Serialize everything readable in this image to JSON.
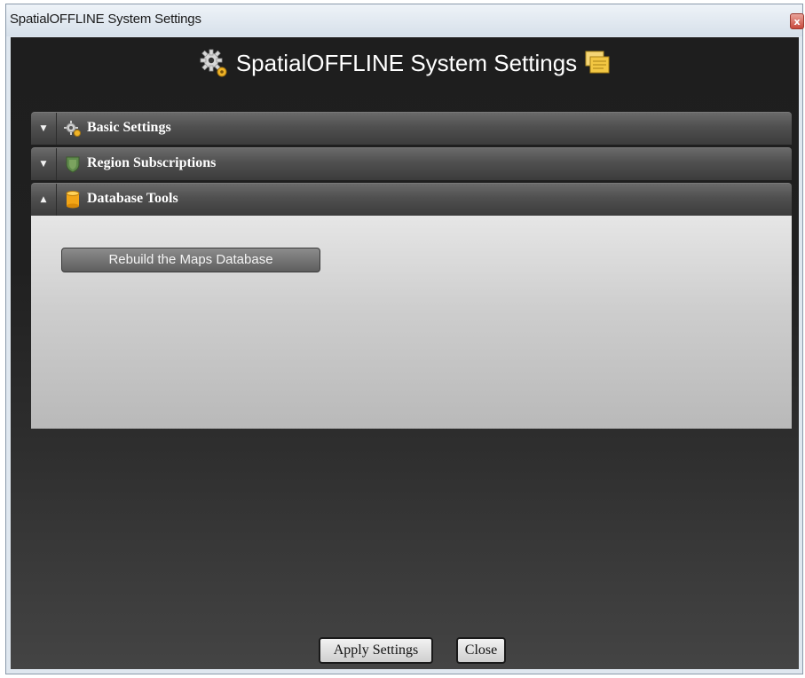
{
  "window": {
    "title": "SpatialOFFLINE System Settings",
    "close_glyph": "x"
  },
  "header": {
    "title": "SpatialOFFLINE System Settings",
    "left_icon": "gear-icon",
    "right_icon": "notes-icon"
  },
  "sections": [
    {
      "label": "Basic Settings",
      "icon": "gear-icon",
      "expanded": false,
      "toggle_glyph": "▼"
    },
    {
      "label": "Region Subscriptions",
      "icon": "shield-icon",
      "expanded": false,
      "toggle_glyph": "▼"
    },
    {
      "label": "Database Tools",
      "icon": "database-icon",
      "expanded": true,
      "toggle_glyph": "▲",
      "body": {
        "button_label": "Rebuild the Maps Database"
      }
    }
  ],
  "footer": {
    "apply_label": "Apply Settings",
    "close_label": "Close"
  },
  "colors": {
    "client_bg": "#1e1e1e",
    "header_text": "#ffffff",
    "section_bar": "#4f4f4f",
    "accent_yellow": "#f0c040"
  }
}
